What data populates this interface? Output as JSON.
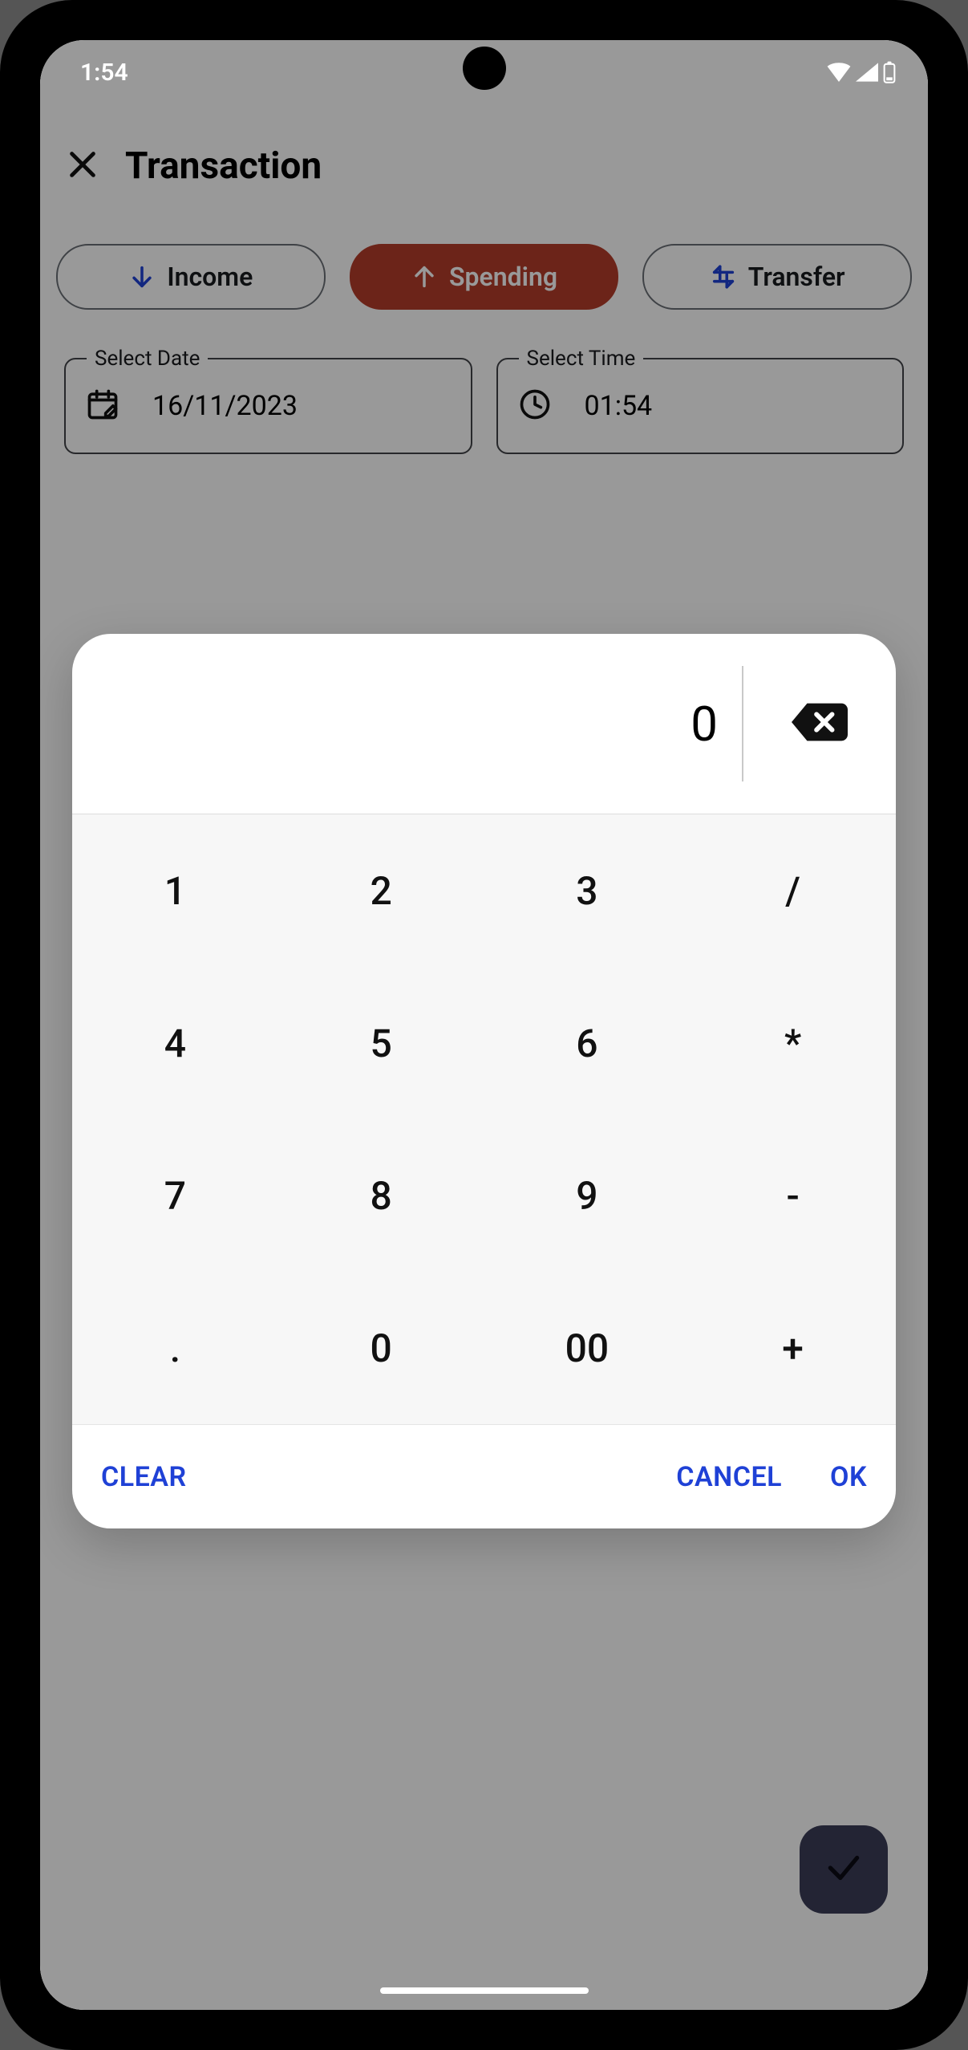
{
  "status": {
    "time": "1:54"
  },
  "appbar": {
    "title": "Transaction"
  },
  "segments": {
    "income": "Income",
    "spending": "Spending",
    "transfer": "Transfer"
  },
  "fields": {
    "date_label": "Select Date",
    "date_value": "16/11/2023",
    "time_label": "Select Time",
    "time_value": "01:54"
  },
  "calculator": {
    "display": "0",
    "keys": {
      "k1": "1",
      "k2": "2",
      "k3": "3",
      "kdiv": "/",
      "k4": "4",
      "k5": "5",
      "k6": "6",
      "kmul": "*",
      "k7": "7",
      "k8": "8",
      "k9": "9",
      "ksub": "-",
      "kdot": ".",
      "k0": "0",
      "k00": "00",
      "kadd": "+"
    },
    "actions": {
      "clear": "CLEAR",
      "cancel": "CANCEL",
      "ok": "OK"
    }
  }
}
